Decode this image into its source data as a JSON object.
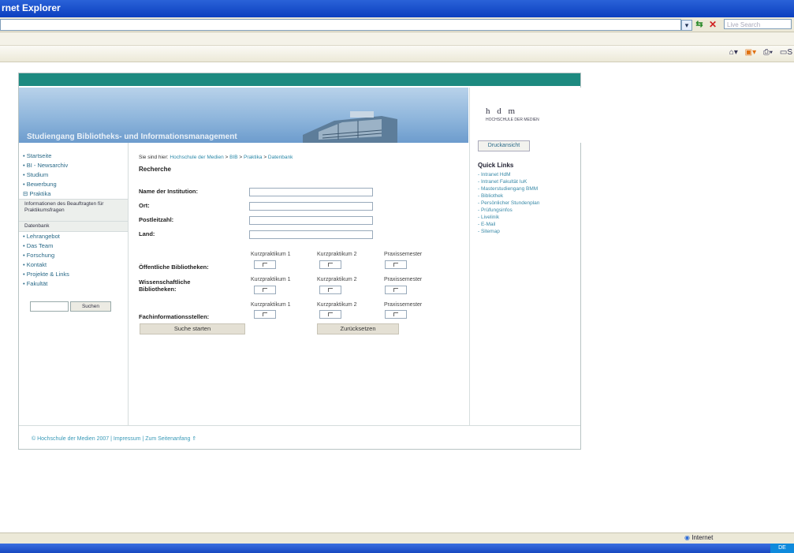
{
  "browser": {
    "title": "rnet Explorer",
    "live_search_placeholder": "Live Search",
    "status_zone": "Internet",
    "tray": "DE"
  },
  "site": {
    "banner_title": "Studiengang Bibliotheks- und Informationsmanagement",
    "logo": "h d m",
    "logo_sub": "HOCHSCHULE DER MEDIEN",
    "print_button": "Druckansicht"
  },
  "sidebar": {
    "items": [
      {
        "label": "• Startseite"
      },
      {
        "label": "• BI - Newsarchiv"
      },
      {
        "label": "• Studium"
      },
      {
        "label": "• Bewerbung"
      },
      {
        "label": "⊟ Praktika"
      }
    ],
    "sub_items": [
      {
        "label": "Informationen des Beauftragten für Praktikumsfragen"
      },
      {
        "label": "Datenbank"
      }
    ],
    "items_after": [
      {
        "label": "• Lehrangebot"
      },
      {
        "label": "• Das Team"
      },
      {
        "label": "• Forschung"
      },
      {
        "label": "• Kontakt"
      },
      {
        "label": "• Projekte & Links"
      },
      {
        "label": "• Fakultät"
      }
    ],
    "search_button": "Suchen"
  },
  "breadcrumb": {
    "prefix": "Sie sind hier:",
    "parts": [
      "Hochschule der Medien",
      ">",
      "BIB",
      ">",
      "Praktika",
      ">",
      "Datenbank"
    ]
  },
  "form": {
    "heading": "Recherche",
    "fields": [
      {
        "label": "Name der Institution:",
        "value": ""
      },
      {
        "label": "Ort:",
        "value": ""
      },
      {
        "label": "Postleitzahl:",
        "value": ""
      },
      {
        "label": "Land:",
        "value": ""
      }
    ],
    "columns": [
      "Kurzpraktikum 1",
      "Kurzpraktikum 2",
      "Praxissemester"
    ],
    "groups": [
      {
        "label": "Öffentliche Bibliotheken:"
      },
      {
        "label": "Wissenschaftliche Bibliotheken:"
      },
      {
        "label": "Fachinformationsstellen:"
      }
    ],
    "submit": "Suche starten",
    "reset": "Zurücksetzen"
  },
  "quick_links": {
    "title": "Quick Links",
    "items": [
      "- Intranet HdM",
      "- Intranet Fakultät IuK",
      "- Masterstudiengang BMM",
      "- Bibliothek",
      "- Persönlicher Stundenplan",
      "- Prüfungsinfos",
      "- Livelinik",
      "- E-Mail",
      "- Sitemap"
    ]
  },
  "footer": {
    "text": "© Hochschule der Medien 2007 | Impressum | Zum Seitenanfang ⇑"
  }
}
